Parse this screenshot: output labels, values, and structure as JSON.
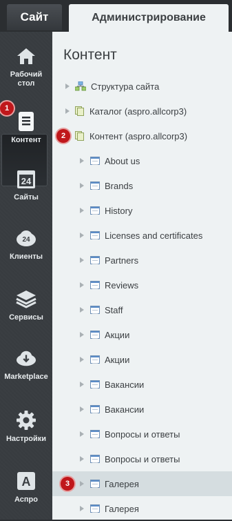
{
  "tabs": {
    "site": "Сайт",
    "admin": "Администрирование"
  },
  "sidebar": [
    {
      "label": "Рабочий\nстол",
      "icon": "home-icon"
    },
    {
      "label": "Контент",
      "icon": "document-icon",
      "active": true
    },
    {
      "label": "Сайты",
      "icon": "calendar-24-icon"
    },
    {
      "label": "Клиенты",
      "icon": "cloud-24-icon"
    },
    {
      "label": "Сервисы",
      "icon": "layers-icon"
    },
    {
      "label": "Marketplace",
      "icon": "cloud-download-icon"
    },
    {
      "label": "Настройки",
      "icon": "gear-icon"
    },
    {
      "label": "Аспро",
      "icon": "aspro-a-icon"
    }
  ],
  "badges": {
    "b1": "1",
    "b2": "2",
    "b3": "3"
  },
  "main": {
    "title": "Контент",
    "tree": [
      {
        "label": "Структура сайта",
        "level": 0,
        "icon": "structure-icon"
      },
      {
        "label": "Каталог (aspro.allcorp3)",
        "level": 0,
        "icon": "iblock-icon"
      },
      {
        "label": "Контент (aspro.allcorp3)",
        "level": 0,
        "icon": "iblock-icon"
      },
      {
        "label": "About us",
        "level": 1,
        "icon": "page-icon"
      },
      {
        "label": "Brands",
        "level": 1,
        "icon": "page-icon"
      },
      {
        "label": "History",
        "level": 1,
        "icon": "page-icon"
      },
      {
        "label": "Licenses and certificates",
        "level": 1,
        "icon": "page-icon"
      },
      {
        "label": "Partners",
        "level": 1,
        "icon": "page-icon"
      },
      {
        "label": "Reviews",
        "level": 1,
        "icon": "page-icon"
      },
      {
        "label": "Staff",
        "level": 1,
        "icon": "page-icon"
      },
      {
        "label": "Акции",
        "level": 1,
        "icon": "page-icon"
      },
      {
        "label": "Акции",
        "level": 1,
        "icon": "page-icon"
      },
      {
        "label": "Вакансии",
        "level": 1,
        "icon": "page-icon"
      },
      {
        "label": "Вакансии",
        "level": 1,
        "icon": "page-icon"
      },
      {
        "label": "Вопросы и ответы",
        "level": 1,
        "icon": "page-icon"
      },
      {
        "label": "Вопросы и ответы",
        "level": 1,
        "icon": "page-icon"
      },
      {
        "label": "Галерея",
        "level": 1,
        "icon": "page-icon",
        "selected": true
      },
      {
        "label": "Галерея",
        "level": 1,
        "icon": "page-icon"
      }
    ]
  }
}
